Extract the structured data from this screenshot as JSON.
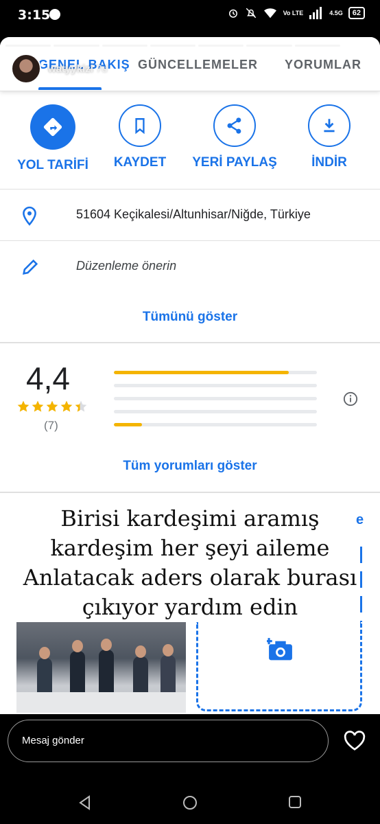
{
  "status": {
    "time": "3:15",
    "network": "4.5G",
    "volte": "Vo LTE",
    "battery": "62"
  },
  "story": {
    "username": "watyykizi",
    "age": "7d"
  },
  "tabs": [
    {
      "label": "GENEL BAKIŞ",
      "active": true
    },
    {
      "label": "GÜNCELLEMELER",
      "active": false
    },
    {
      "label": "YORUMLAR",
      "active": false
    }
  ],
  "actions": [
    {
      "label": "YOL TARİFİ",
      "icon": "directions-icon"
    },
    {
      "label": "KAYDET",
      "icon": "bookmark-icon"
    },
    {
      "label": "YERİ PAYLAŞ",
      "icon": "share-icon"
    },
    {
      "label": "İNDİR",
      "icon": "download-icon"
    }
  ],
  "address": "51604 Keçikalesi/Altunhisar/Niğde, Türkiye",
  "suggest_edit": "Düzenleme önerin",
  "show_all": "Tümünü göster",
  "rating": {
    "value": "4,4",
    "stars": 4.4,
    "count": "(7)",
    "distribution": [
      0.86,
      0.0,
      0.0,
      0.0,
      0.14
    ]
  },
  "show_all_reviews": "Tüm yorumları göster",
  "caption_lines": [
    "Birisi kardeşimi aramış",
    "kardeşim her şeyi aileme",
    "Anlatacak aders olarak burası",
    "çıkıyor yardım edin"
  ],
  "reply_placeholder": "Mesaj gönder",
  "colors": {
    "accent": "#1a73e8",
    "star": "#f4b400"
  }
}
